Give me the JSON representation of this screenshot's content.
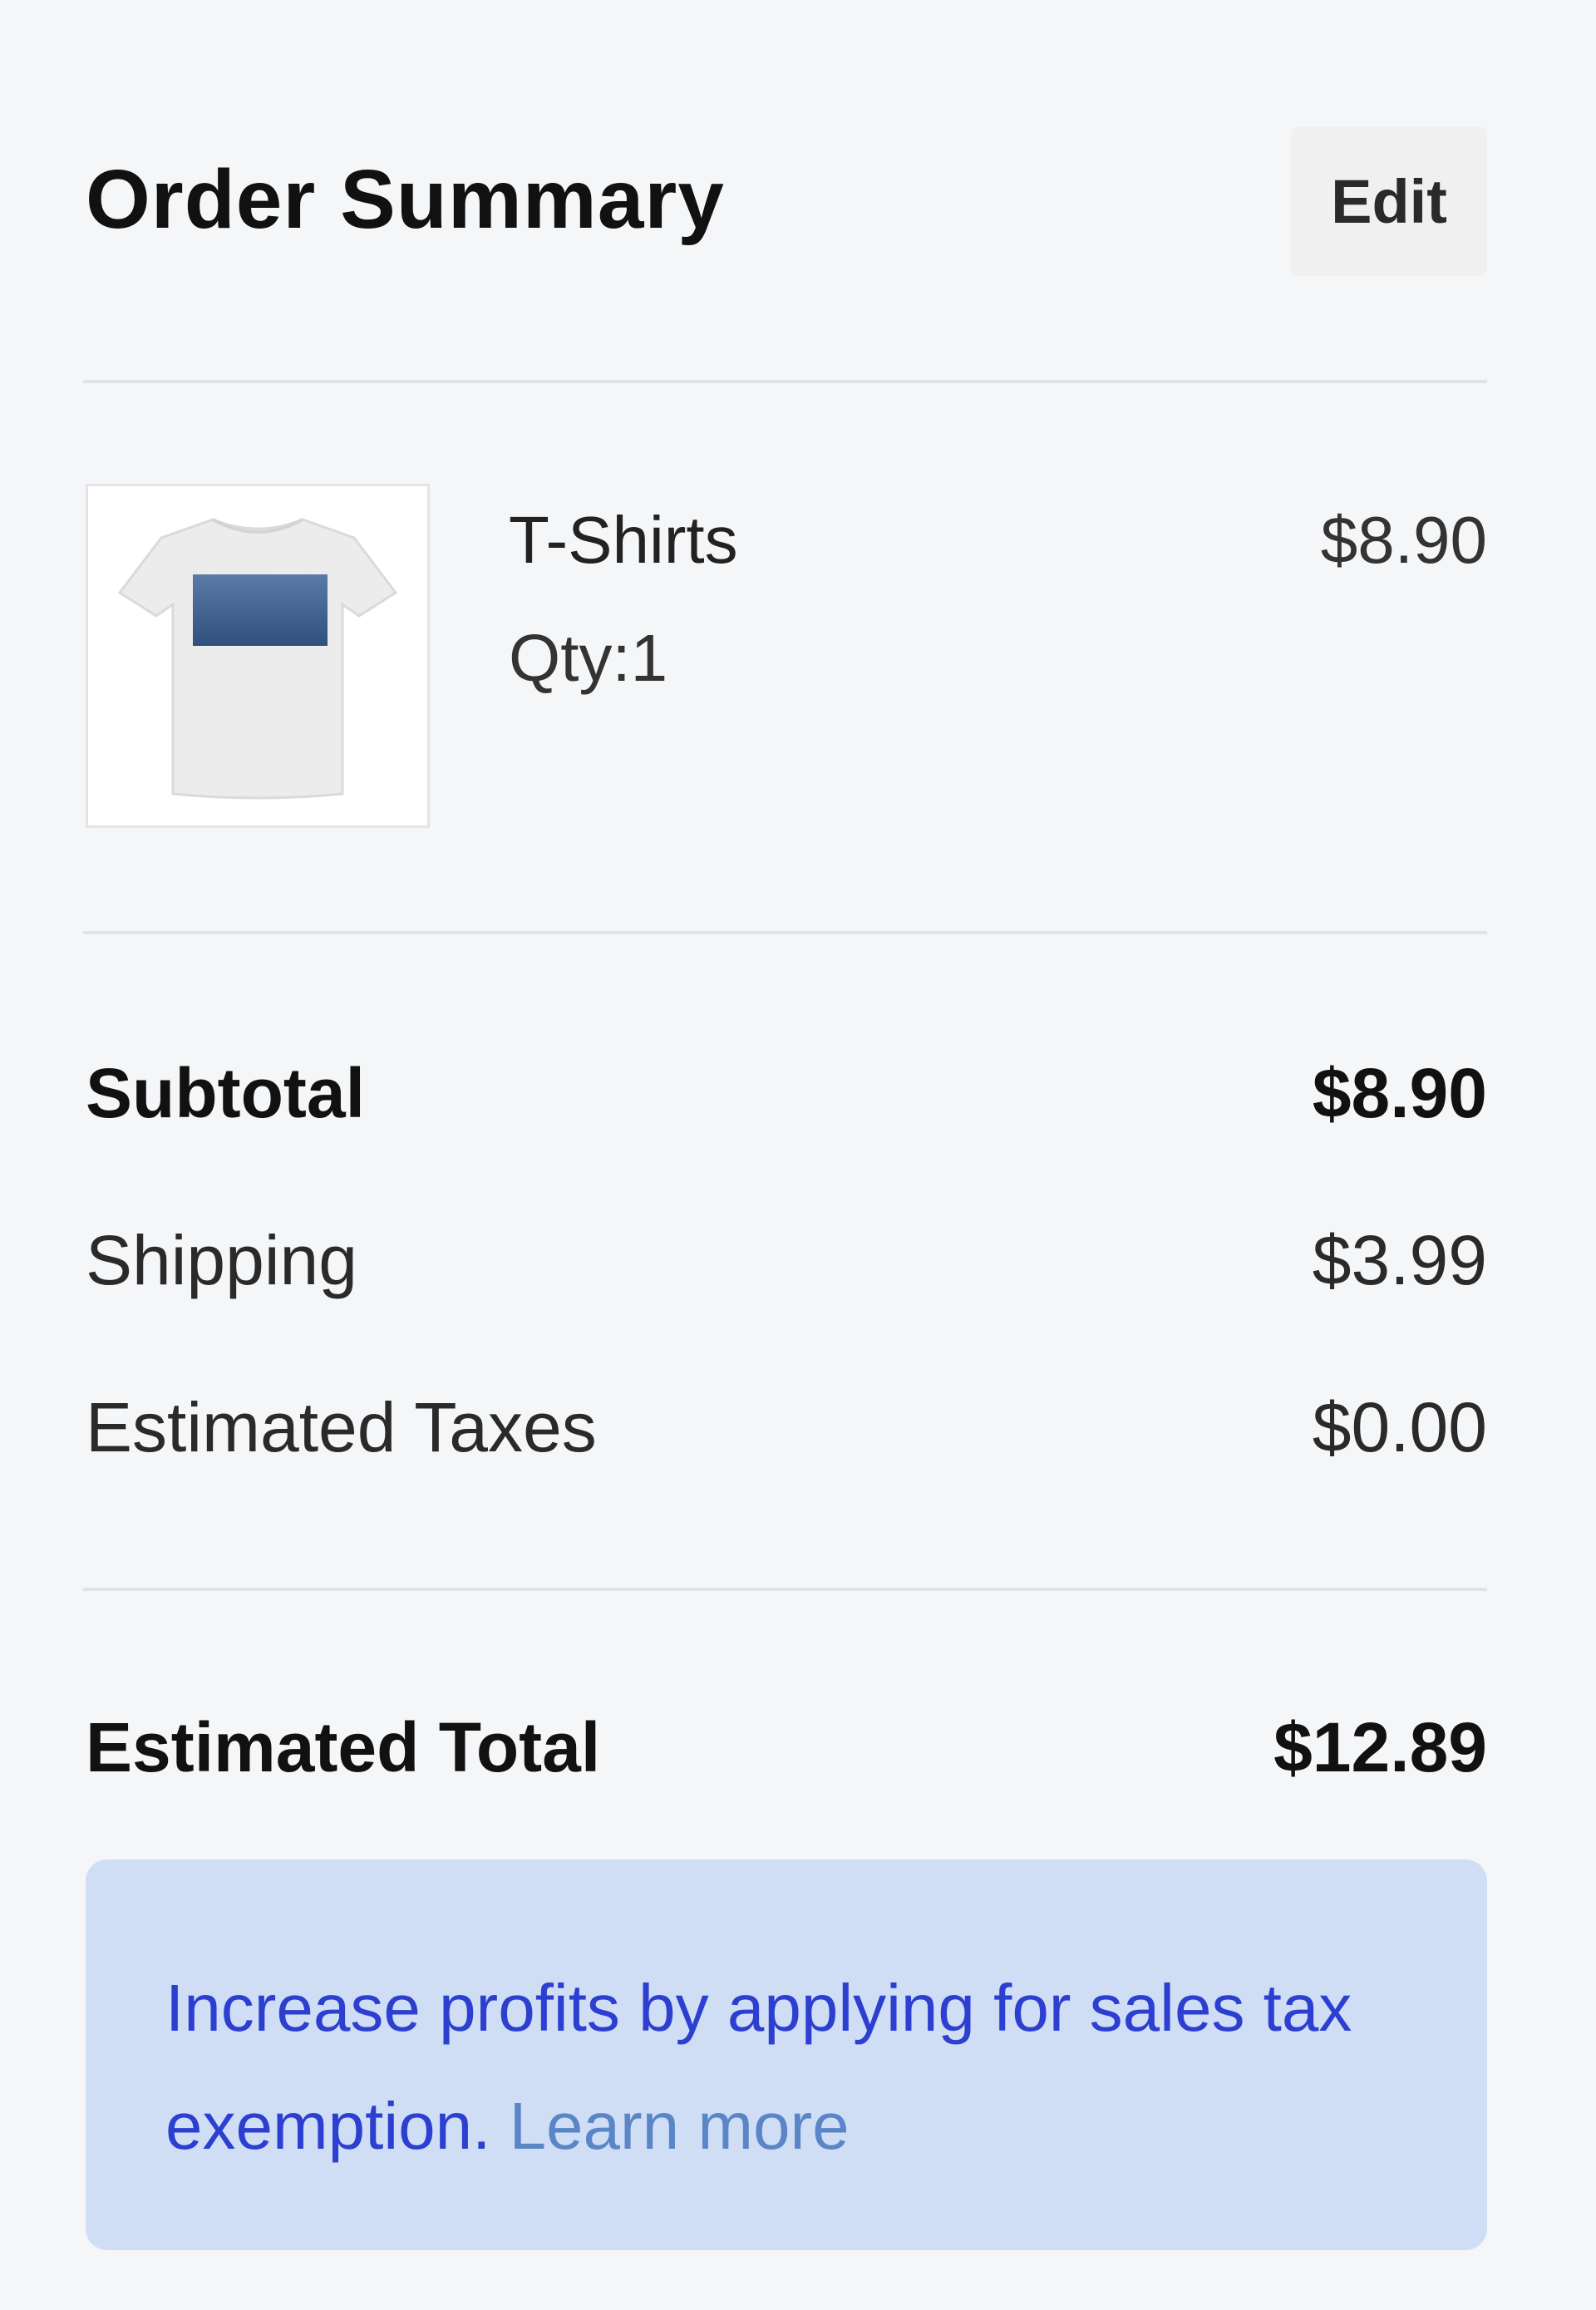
{
  "header": {
    "title": "Order Summary",
    "edit_label": "Edit"
  },
  "item": {
    "name": "T-Shirts",
    "qty": "Qty:1",
    "price": "$8.90",
    "thumbnail_icon": "t-shirt-image"
  },
  "summary": {
    "subtotal_label": "Subtotal",
    "subtotal_value": "$8.90",
    "shipping_label": "Shipping",
    "shipping_value": "$3.99",
    "taxes_label": "Estimated Taxes",
    "taxes_value": "$0.00",
    "total_label": "Estimated Total",
    "total_value": "$12.89"
  },
  "notice": {
    "text": "Increase profits by applying for sales tax exemption.",
    "link_label": "Learn more",
    "background_color": "#d0def5",
    "text_color": "#2d3fd0",
    "link_color": "#5a86c8"
  }
}
